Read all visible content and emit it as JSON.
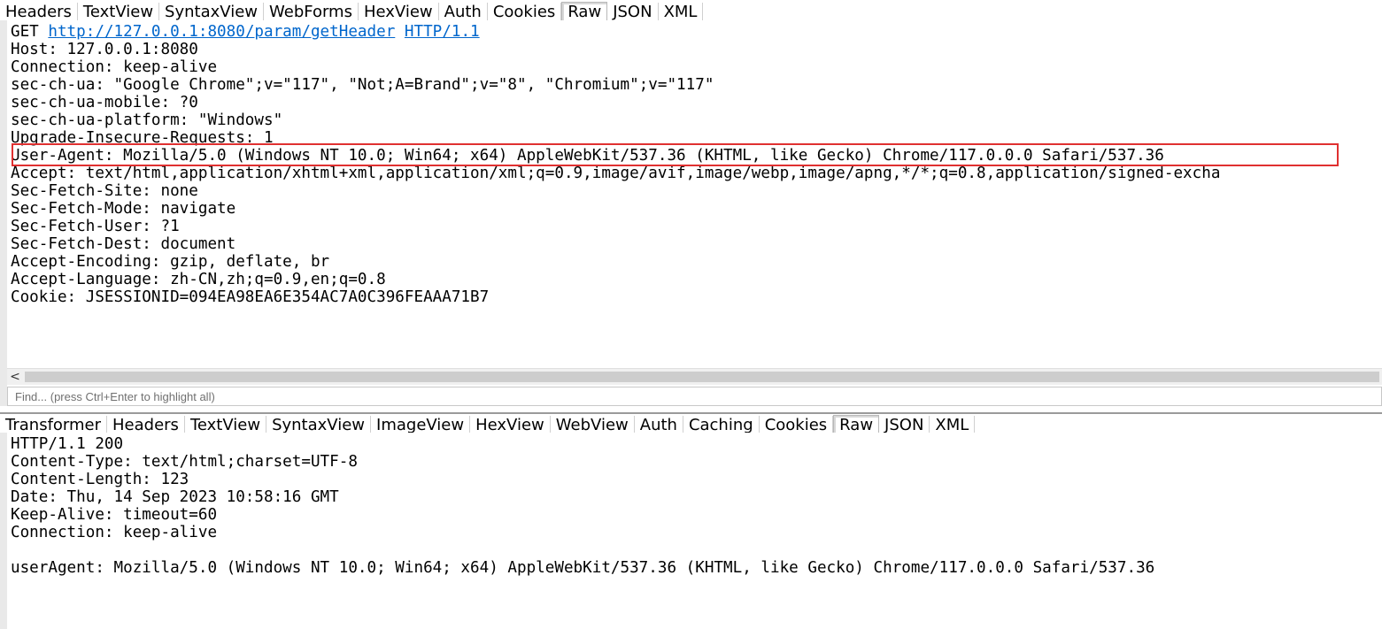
{
  "request_tabs": [
    "Headers",
    "TextView",
    "SyntaxView",
    "WebForms",
    "HexView",
    "Auth",
    "Cookies",
    "Raw",
    "JSON",
    "XML"
  ],
  "request_active_tab": "Raw",
  "request": {
    "method": "GET",
    "url": "http://127.0.0.1:8080/param/getHeader",
    "protocol": "HTTP/1.1",
    "headers": [
      "Host: 127.0.0.1:8080",
      "Connection: keep-alive",
      "sec-ch-ua: \"Google Chrome\";v=\"117\", \"Not;A=Brand\";v=\"8\", \"Chromium\";v=\"117\"",
      "sec-ch-ua-mobile: ?0",
      "sec-ch-ua-platform: \"Windows\"",
      "Upgrade-Insecure-Requests: 1",
      "User-Agent: Mozilla/5.0 (Windows NT 10.0; Win64; x64) AppleWebKit/537.36 (KHTML, like Gecko) Chrome/117.0.0.0 Safari/537.36",
      "Accept: text/html,application/xhtml+xml,application/xml;q=0.9,image/avif,image/webp,image/apng,*/*;q=0.8,application/signed-excha",
      "Sec-Fetch-Site: none",
      "Sec-Fetch-Mode: navigate",
      "Sec-Fetch-User: ?1",
      "Sec-Fetch-Dest: document",
      "Accept-Encoding: gzip, deflate, br",
      "Accept-Language: zh-CN,zh;q=0.9,en;q=0.8",
      "Cookie: JSESSIONID=094EA98EA6E354AC7A0C396FEAAA71B7"
    ]
  },
  "find_placeholder": "Find... (press Ctrl+Enter to highlight all)",
  "scroll_left_arrow": "<",
  "response_tabs": [
    "Transformer",
    "Headers",
    "TextView",
    "SyntaxView",
    "ImageView",
    "HexView",
    "WebView",
    "Auth",
    "Caching",
    "Cookies",
    "Raw",
    "JSON",
    "XML"
  ],
  "response_active_tab": "Raw",
  "response": {
    "lines": [
      "HTTP/1.1 200",
      "Content-Type: text/html;charset=UTF-8",
      "Content-Length: 123",
      "Date: Thu, 14 Sep 2023 10:58:16 GMT",
      "Keep-Alive: timeout=60",
      "Connection: keep-alive",
      "",
      "userAgent: Mozilla/5.0 (Windows NT 10.0; Win64; x64) AppleWebKit/537.36 (KHTML, like Gecko) Chrome/117.0.0.0 Safari/537.36"
    ]
  },
  "highlight_color": "#e03030",
  "link_color": "#0066cc"
}
